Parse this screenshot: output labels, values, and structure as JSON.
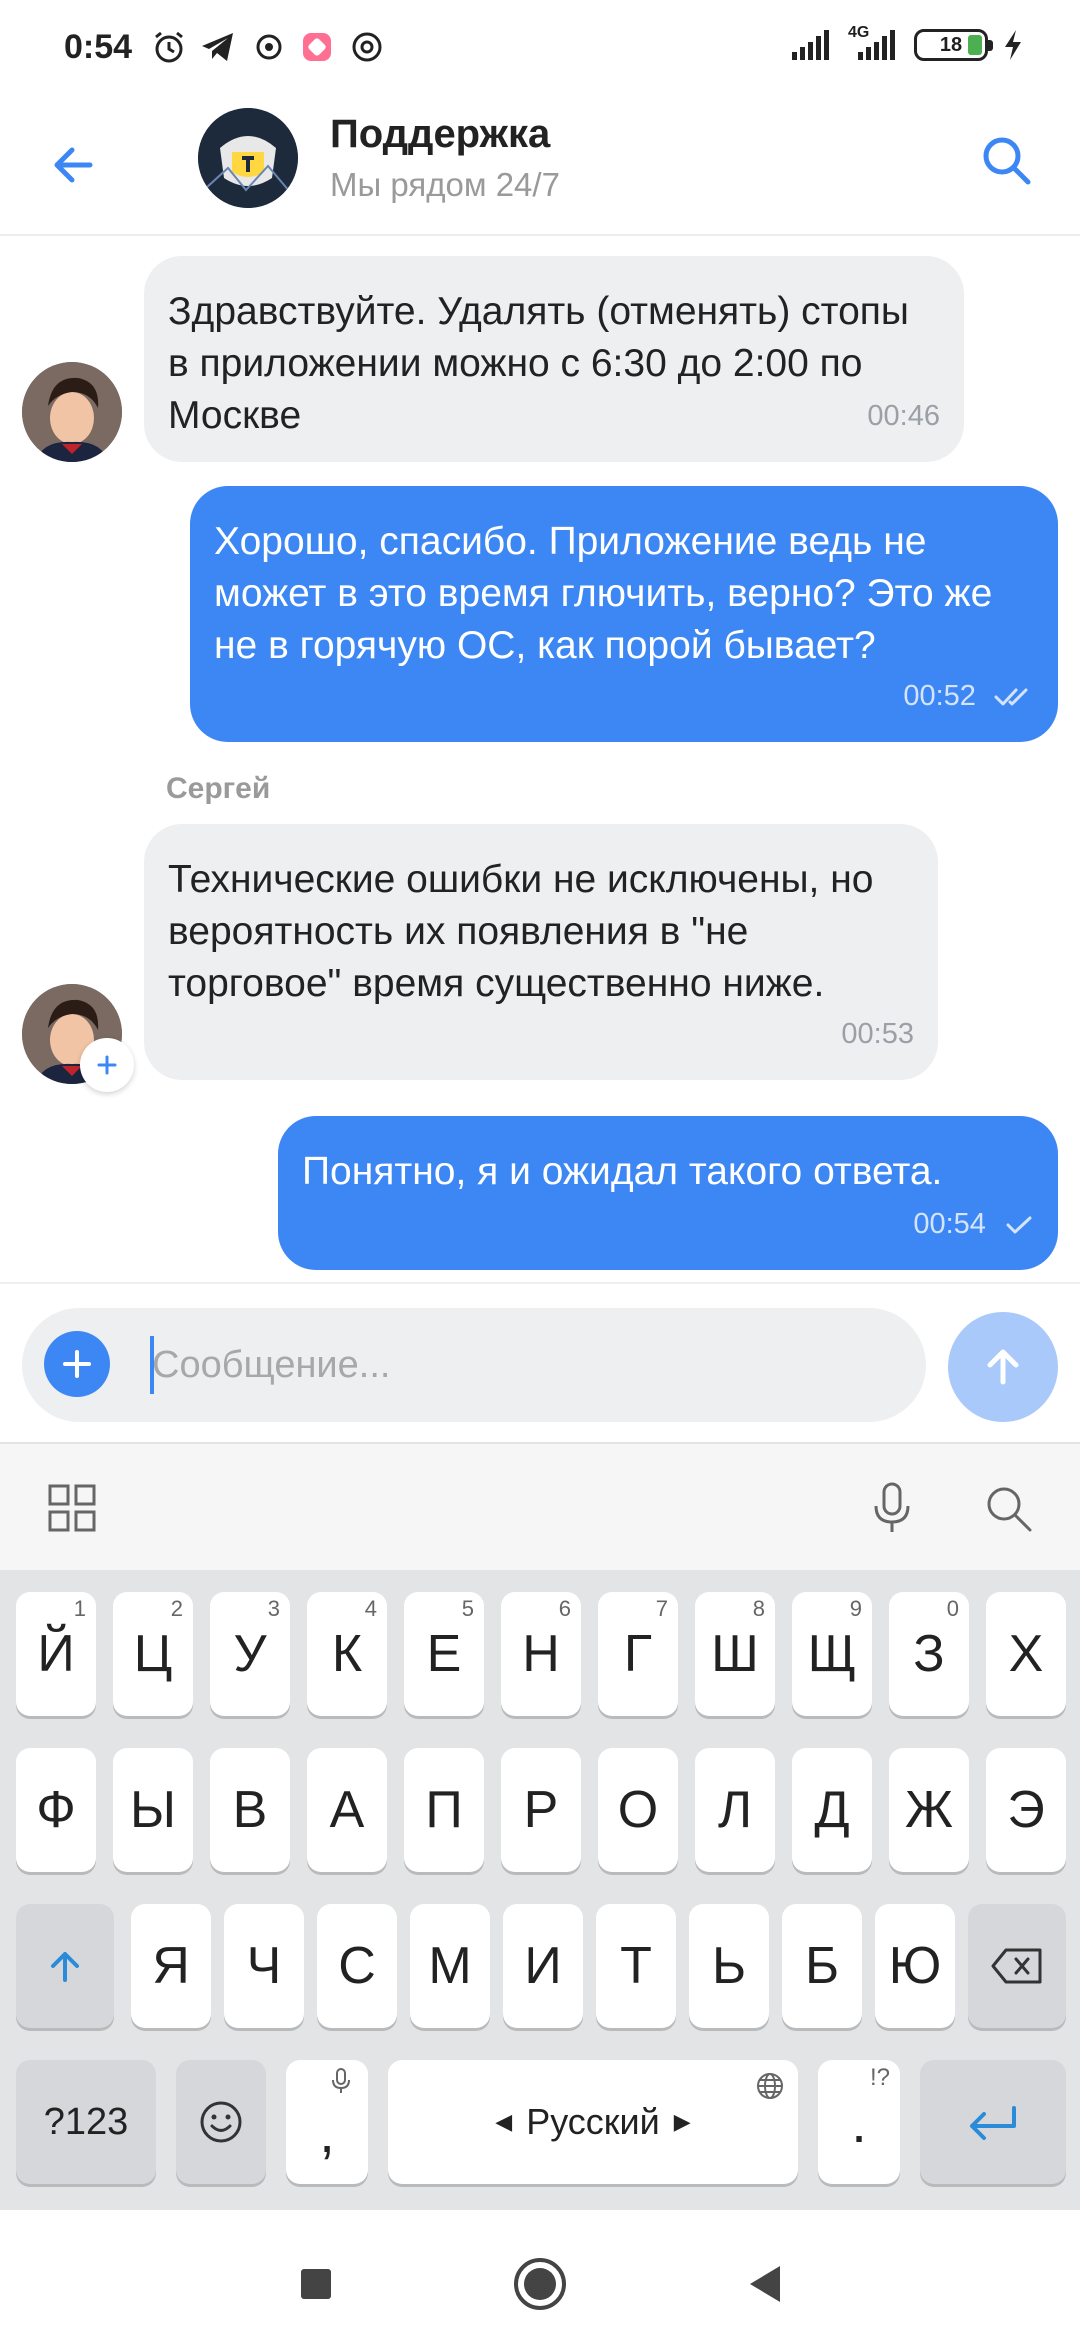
{
  "status_bar": {
    "time": "0:54",
    "network": "4G",
    "battery": "18"
  },
  "header": {
    "title": "Поддержка",
    "subtitle": "Мы рядом 24/7"
  },
  "messages": [
    {
      "direction": "incoming",
      "text": "Здравствуйте. Удалять (отменять) стопы в приложении можно с 6:30 до 2:00 по Москве",
      "time": "00:46"
    },
    {
      "direction": "outgoing",
      "text": "Хорошо, спасибо. Приложение ведь не может в это время глючить, верно? Это же не в горячую ОС, как порой бывает?",
      "time": "00:52",
      "status": "read"
    },
    {
      "direction": "incoming",
      "sender": "Сергей",
      "text": "Технические ошибки не исключены, но вероятность их появления в \"не торговое\" время существенно ниже.",
      "time": "00:53"
    },
    {
      "direction": "outgoing",
      "text": "Понятно, я и ожидал такого ответа.",
      "time": "00:54",
      "status": "sent"
    }
  ],
  "composer": {
    "placeholder": "Сообщение..."
  },
  "keyboard": {
    "row1": [
      {
        "label": "Й",
        "hint": "1"
      },
      {
        "label": "Ц",
        "hint": "2"
      },
      {
        "label": "У",
        "hint": "3"
      },
      {
        "label": "К",
        "hint": "4"
      },
      {
        "label": "Е",
        "hint": "5"
      },
      {
        "label": "Н",
        "hint": "6"
      },
      {
        "label": "Г",
        "hint": "7"
      },
      {
        "label": "Ш",
        "hint": "8"
      },
      {
        "label": "Щ",
        "hint": "9"
      },
      {
        "label": "З",
        "hint": "0"
      },
      {
        "label": "Х",
        "hint": ""
      }
    ],
    "row2": [
      "Ф",
      "Ы",
      "В",
      "А",
      "П",
      "Р",
      "О",
      "Л",
      "Д",
      "Ж",
      "Э"
    ],
    "row3": [
      "Я",
      "Ч",
      "С",
      "М",
      "И",
      "Т",
      "Ь",
      "Б",
      "Ю"
    ],
    "symbols_label": "?123",
    "comma": ",",
    "period": ".",
    "period_hint": "!?",
    "space_label": "Русский"
  },
  "colors": {
    "accent": "#3d87f5",
    "incoming_bubble": "#eeeff1",
    "send_disabled": "#a9c9fb"
  },
  "icons": {
    "back": "arrow-left-icon",
    "search": "search-icon",
    "attach": "plus-icon",
    "send": "arrow-up-icon",
    "grid": "grid-icon",
    "mic": "microphone-icon",
    "shift": "shift-icon",
    "backspace": "backspace-icon",
    "emoji": "emoji-icon",
    "enter": "enter-icon",
    "globe": "globe-icon"
  }
}
